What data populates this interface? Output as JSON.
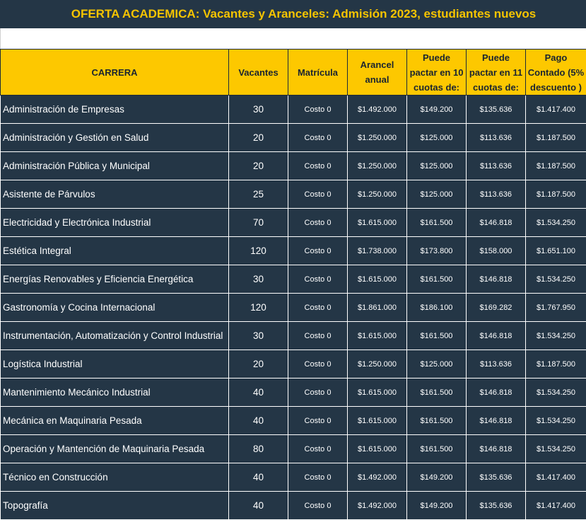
{
  "title": "OFERTA ACADEMICA: Vacantes y Aranceles: Admisión 2023, estudiantes  nuevos",
  "headers": {
    "carrera": "CARRERA",
    "vacantes": "Vacantes",
    "matricula": "Matrícula",
    "arancel_l1": "Arancel",
    "arancel_l2": "anual",
    "cuotas10_l1": "Puede",
    "cuotas10_l2": "pactar en 10",
    "cuotas10_l3": "cuotas de:",
    "cuotas11_l1": "Puede",
    "cuotas11_l2": "pactar en 11",
    "cuotas11_l3": "cuotas de:",
    "contado_l1": "Pago",
    "contado_l2": "Contado (5%",
    "contado_l3": "descuento )"
  },
  "rows": [
    {
      "carrera": "Administración de Empresas",
      "vacantes": "30",
      "matricula": "Costo 0",
      "arancel": "$1.492.000",
      "cuotas10": "$149.200",
      "cuotas11": "$135.636",
      "contado": "$1.417.400"
    },
    {
      "carrera": "Administración y Gestión en Salud",
      "vacantes": "20",
      "matricula": "Costo 0",
      "arancel": "$1.250.000",
      "cuotas10": "$125.000",
      "cuotas11": "$113.636",
      "contado": "$1.187.500"
    },
    {
      "carrera": "Administración Pública y Municipal",
      "vacantes": "20",
      "matricula": "Costo 0",
      "arancel": "$1.250.000",
      "cuotas10": "$125.000",
      "cuotas11": "$113.636",
      "contado": "$1.187.500"
    },
    {
      "carrera": "Asistente de Párvulos",
      "vacantes": "25",
      "matricula": "Costo 0",
      "arancel": "$1.250.000",
      "cuotas10": "$125.000",
      "cuotas11": "$113.636",
      "contado": "$1.187.500"
    },
    {
      "carrera": "Electricidad y Electrónica Industrial",
      "vacantes": "70",
      "matricula": "Costo 0",
      "arancel": "$1.615.000",
      "cuotas10": "$161.500",
      "cuotas11": "$146.818",
      "contado": "$1.534.250"
    },
    {
      "carrera": "Estética Integral",
      "vacantes": "120",
      "matricula": "Costo 0",
      "arancel": "$1.738.000",
      "cuotas10": "$173.800",
      "cuotas11": "$158.000",
      "contado": "$1.651.100"
    },
    {
      "carrera": "Energías Renovables y Eficiencia Energética",
      "vacantes": "30",
      "matricula": "Costo 0",
      "arancel": "$1.615.000",
      "cuotas10": "$161.500",
      "cuotas11": "$146.818",
      "contado": "$1.534.250"
    },
    {
      "carrera": "Gastronomía y Cocina Internacional",
      "vacantes": "120",
      "matricula": "Costo 0",
      "arancel": "$1.861.000",
      "cuotas10": "$186.100",
      "cuotas11": "$169.282",
      "contado": "$1.767.950"
    },
    {
      "carrera": "Instrumentación,  Automatización y Control Industrial",
      "vacantes": "30",
      "matricula": "Costo 0",
      "arancel": "$1.615.000",
      "cuotas10": "$161.500",
      "cuotas11": "$146.818",
      "contado": "$1.534.250"
    },
    {
      "carrera": "Logística Industrial",
      "vacantes": "20",
      "matricula": "Costo 0",
      "arancel": "$1.250.000",
      "cuotas10": "$125.000",
      "cuotas11": "$113.636",
      "contado": "$1.187.500"
    },
    {
      "carrera": "Mantenimiento Mecánico Industrial",
      "vacantes": "40",
      "matricula": "Costo 0",
      "arancel": "$1.615.000",
      "cuotas10": "$161.500",
      "cuotas11": "$146.818",
      "contado": "$1.534.250"
    },
    {
      "carrera": "Mecánica en Maquinaria Pesada",
      "vacantes": "40",
      "matricula": "Costo 0",
      "arancel": "$1.615.000",
      "cuotas10": "$161.500",
      "cuotas11": "$146.818",
      "contado": "$1.534.250"
    },
    {
      "carrera": "Operación y Mantención de Maquinaria Pesada",
      "vacantes": "80",
      "matricula": "Costo 0",
      "arancel": "$1.615.000",
      "cuotas10": "$161.500",
      "cuotas11": "$146.818",
      "contado": "$1.534.250"
    },
    {
      "carrera": "Técnico en Construcción",
      "vacantes": "40",
      "matricula": "Costo 0",
      "arancel": "$1.492.000",
      "cuotas10": "$149.200",
      "cuotas11": "$135.636",
      "contado": "$1.417.400"
    },
    {
      "carrera": "Topografía",
      "vacantes": "40",
      "matricula": "Costo 0",
      "arancel": "$1.492.000",
      "cuotas10": "$149.200",
      "cuotas11": "$135.636",
      "contado": "$1.417.400"
    }
  ]
}
